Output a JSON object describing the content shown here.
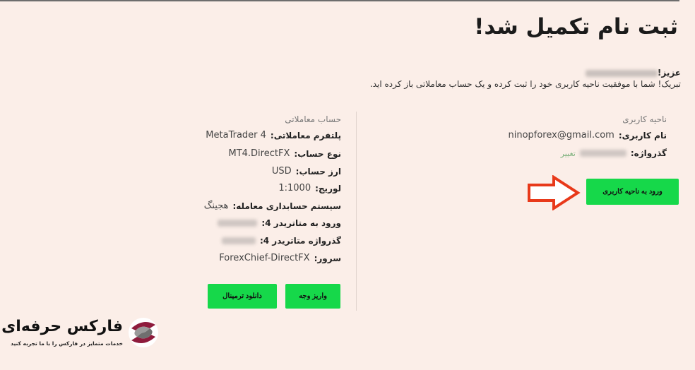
{
  "header": {
    "title": "ثبت نام تکمیل شد!"
  },
  "greeting": {
    "salutation": "عزیز!",
    "message": "تبریک! شما با موفقیت ناحیه کاربری خود را ثبت کرده و یک حساب معاملاتی باز کرده اید."
  },
  "user_area": {
    "title": "ناحیه کاربری",
    "username_label": "نام کاربری:",
    "username_value": "ninopforex@gmail.com",
    "password_label": "گذرواژه:",
    "change_link": "تغییر",
    "login_button": "ورود به ناحیه کاربری"
  },
  "trading_account": {
    "title": "حساب معاملاتی",
    "rows": [
      {
        "label": "پلتفرم معاملاتی:",
        "value": "MetaTrader 4"
      },
      {
        "label": "نوع حساب:",
        "value": "MT4.DirectFX"
      },
      {
        "label": "ارز حساب:",
        "value": "USD"
      },
      {
        "label": "لوریج:",
        "value": "1:1000"
      },
      {
        "label": "سیستم حسابداری معامله:",
        "value": "هجینگ"
      },
      {
        "label": "ورود به متاتریدر 4:",
        "value": ""
      },
      {
        "label": "گذرواژه متاتریدر 4:",
        "value": ""
      },
      {
        "label": "سرور:",
        "value": "ForexChief-DirectFX"
      }
    ],
    "deposit_button": "واریز وجه",
    "download_button": "دانلود ترمینال"
  },
  "branding": {
    "logo_text": "فارکس حرفه‌ای",
    "tagline": "خدمات متمایز در فارکس را با ما تجربه کنید"
  },
  "colors": {
    "background": "#fbeee8",
    "accent_green": "#16d84a",
    "arrow_red": "#e8391a",
    "logo_maroon": "#8e1b3c"
  }
}
